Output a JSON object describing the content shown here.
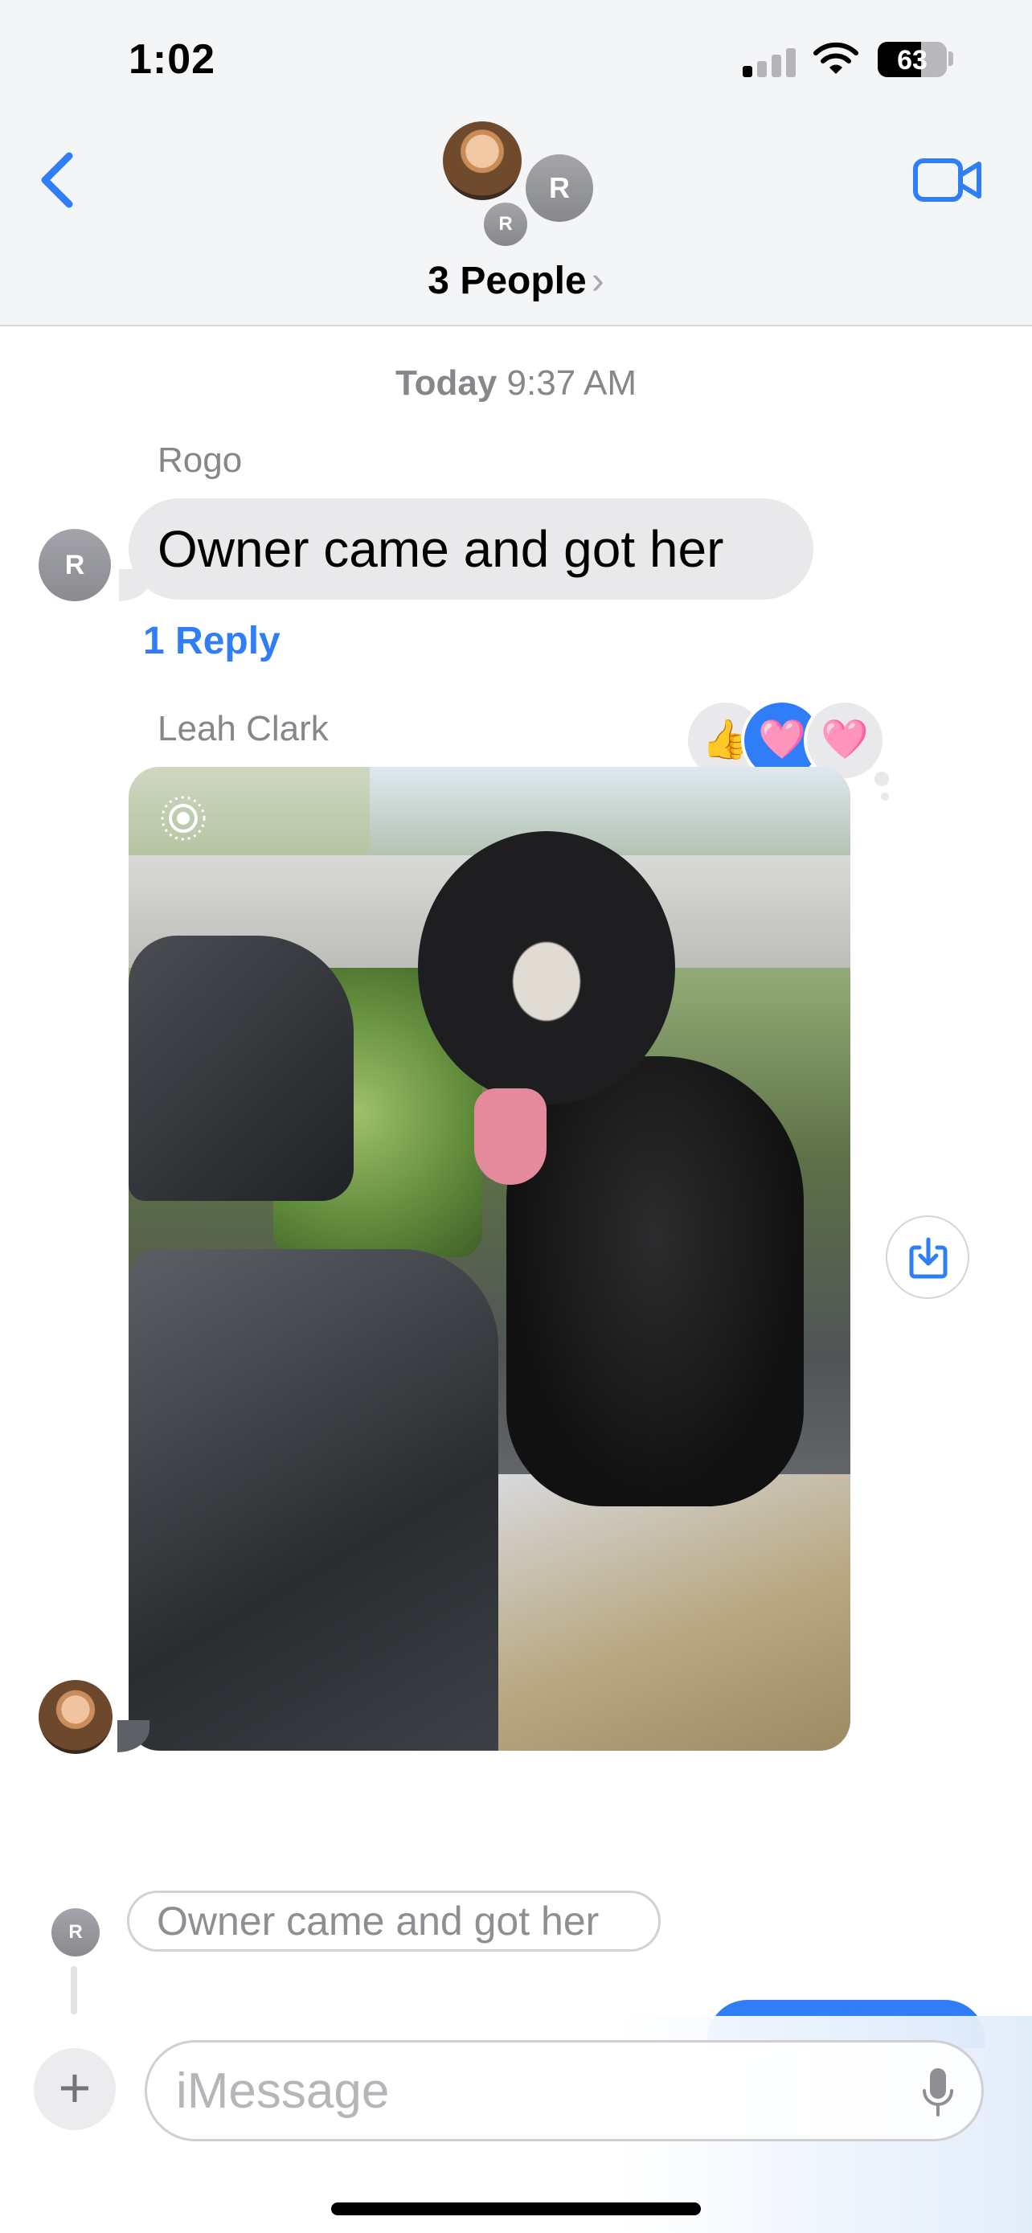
{
  "status_bar": {
    "time": "1:02",
    "battery": "63",
    "battery_level": 0.63
  },
  "header": {
    "avatar_initial": "R",
    "avatar_initial_small": "R",
    "title": "3 People",
    "title_chevron": "›"
  },
  "conversation": {
    "timestamp_day": "Today",
    "timestamp_time": "9:37 AM",
    "messages": [
      {
        "sender": "Rogo",
        "avatar_initial": "R",
        "text": "Owner came and got her",
        "reply_link": "1 Reply"
      },
      {
        "sender": "Leah Clark",
        "attachment": "photo",
        "reactions": [
          "👍",
          "🩷",
          "🩷"
        ]
      }
    ],
    "thread_preview": {
      "avatar_initial": "R",
      "text": "Owner came and got her"
    }
  },
  "composer": {
    "plus_label": "+",
    "placeholder": "iMessage"
  },
  "colors": {
    "accent": "#2f7ef7",
    "bubble_gray": "#e9e9eb",
    "secondary_text": "#86868b"
  },
  "icons": [
    "back-chevron-icon",
    "video-camera-icon",
    "live-photo-icon",
    "save-download-icon",
    "microphone-icon",
    "wifi-icon",
    "signal-icon",
    "battery-icon"
  ]
}
